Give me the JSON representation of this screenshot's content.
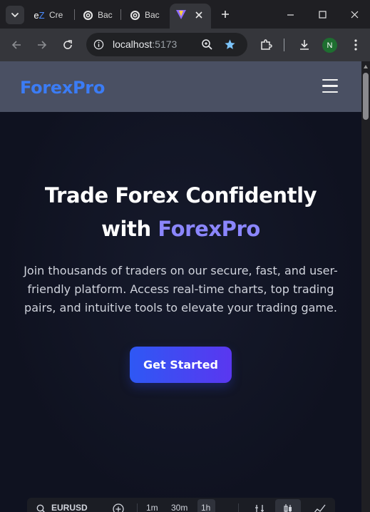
{
  "browser": {
    "tabs": [
      {
        "icon": "ez-icon",
        "title": "Cre"
      },
      {
        "icon": "openai-icon",
        "title": "Bac"
      },
      {
        "icon": "openai-icon",
        "title": "Bac"
      },
      {
        "icon": "vite-icon",
        "title": ""
      }
    ],
    "address": {
      "host": "localhost",
      "port": ":5173"
    },
    "profile_initial": "N"
  },
  "navbar": {
    "brand": "ForexPro",
    "menu_icon": "hamburger-menu-icon"
  },
  "hero": {
    "title_line1": "Trade Forex Confidently",
    "title_with": "with ",
    "title_accent": "ForexPro",
    "description": "Join thousands of traders on our secure, fast, and user-friendly platform. Access real-time charts, top trading pairs, and intuitive tools to elevate your trading game.",
    "cta_label": "Get Started"
  },
  "chart_toolbar": {
    "symbol": "EURUSD",
    "intervals": [
      "1m",
      "30m",
      "1h"
    ],
    "active_interval": "1h"
  },
  "colors": {
    "brand": "#3b7cf5",
    "accent": "#8b86ff",
    "cta_start": "#2e58f4",
    "cta_end": "#5a37f0",
    "navbar_bg": "#4a5063",
    "page_bg": "#0f1220"
  }
}
